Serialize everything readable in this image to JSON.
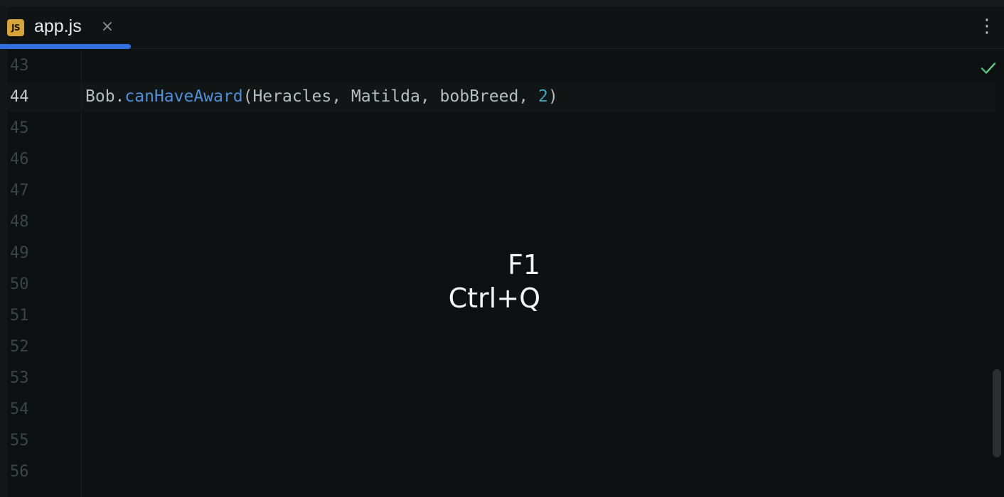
{
  "tab": {
    "icon_text": "JS",
    "label": "app.js",
    "close_glyph": "×"
  },
  "menu_glyph": "⋮",
  "gutter": {
    "line_numbers": [
      "43",
      "44",
      "45",
      "46",
      "47",
      "48",
      "49",
      "50",
      "51",
      "52",
      "53",
      "54",
      "55",
      "56"
    ],
    "current_line": "44"
  },
  "code": {
    "line_44": {
      "object": "Bob",
      "dot": ".",
      "method": "canHaveAward",
      "open": "(",
      "args": "Heracles, Matilda, bobBreed, ",
      "number": "2",
      "close": ")"
    }
  },
  "status_icon": "check-icon",
  "shortcut_overlay": {
    "line1": "F1",
    "line2": "Ctrl+Q"
  },
  "colors": {
    "accent": "#2f6fe0",
    "method": "#4e8fd6",
    "number": "#3fa5c3",
    "js_badge": "#d7a43b",
    "inspection_ok": "#4caf6a"
  }
}
